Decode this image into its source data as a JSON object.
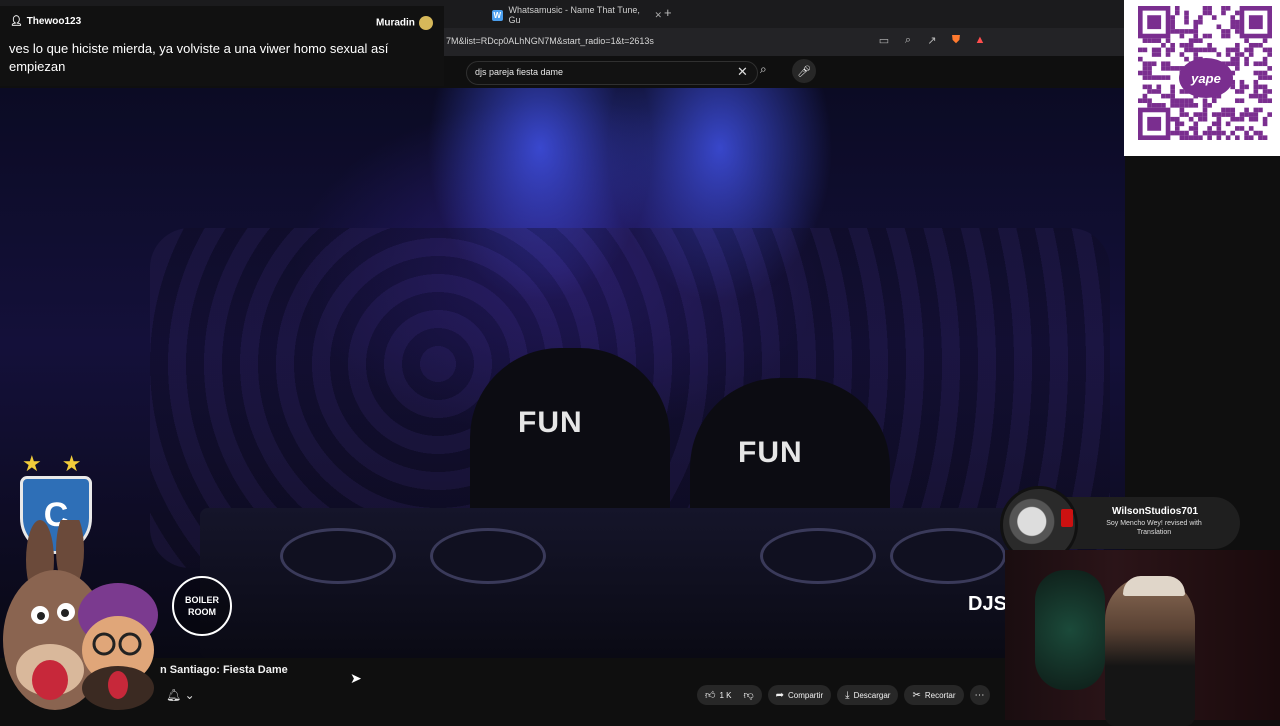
{
  "browser": {
    "tab_title": "Whatsamusic - Name That Tune, Gu",
    "tab_favicon": "W",
    "url_fragment": "7M&list=RDcp0ALhNGN7M&start_radio=1&t=2613s",
    "icons": [
      "screen-cast-icon",
      "zoom-icon",
      "share-icon",
      "brave-shield-icon",
      "brave-rewards-icon"
    ]
  },
  "youtube": {
    "search_query": "djs pareja fiesta dame",
    "video_title": "n Santiago: Fiesta Dame",
    "actions": {
      "like_count": "1 K",
      "share_label": "Compartir",
      "download_label": "Descargar",
      "clip_label": "Recortar"
    },
    "video_overlay": {
      "watermark": "DJS",
      "logo_line1": "BOILER",
      "logo_line2": "ROOM",
      "shirt_text": "FUN"
    }
  },
  "chat": {
    "username": "Thewoo123",
    "moderator": "Muradin",
    "message": "ves lo que hiciste mierda, ya volviste a una viwer homo sexual así empiezan"
  },
  "qr": {
    "label": "yape"
  },
  "notification": {
    "name": "WilsonStudios701",
    "subtitle": "Soy Mencho Wey! revised with Translation"
  },
  "colors": {
    "yt_bg": "#0f0f0f",
    "pill_bg": "#272727",
    "qr_brand": "#7a2e8f",
    "stage_blue": "#4658ff"
  }
}
